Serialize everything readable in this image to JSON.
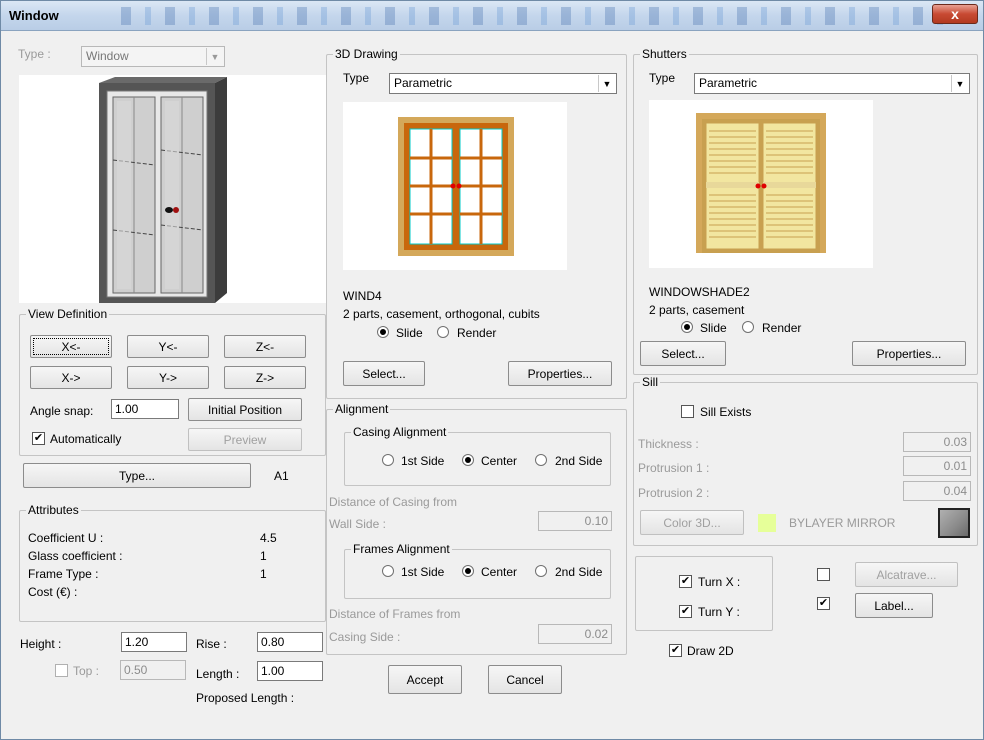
{
  "window": {
    "title": "Window",
    "close": "x"
  },
  "type_row": {
    "label": "Type :",
    "value": "Window"
  },
  "view_definition": {
    "legend": "View Definition",
    "buttons": [
      "X<-",
      "Y<-",
      "Z<-",
      "X->",
      "Y->",
      "Z->"
    ],
    "angle_snap_label": "Angle snap:",
    "angle_snap_value": "1.00",
    "initial_position": "Initial Position",
    "automatically_label": "Automatically",
    "automatically_checked": true,
    "preview": "Preview"
  },
  "type_button": "Type...",
  "type_code": "A1",
  "attributes": {
    "legend": "Attributes",
    "rows": [
      {
        "label": "Coefficient U :",
        "value": "4.5"
      },
      {
        "label": "Glass coefficient :",
        "value": "1"
      },
      {
        "label": "Frame Type :",
        "value": "1"
      },
      {
        "label": "Cost (€) :",
        "value": ""
      }
    ]
  },
  "dimensions": {
    "height_label": "Height :",
    "height_value": "1.20",
    "rise_label": "Rise :",
    "rise_value": "0.80",
    "top_label": "Top :",
    "top_value": "0.50",
    "length_label": "Length :",
    "length_value": "1.00",
    "proposed_length_label": "Proposed Length :"
  },
  "drawing3d": {
    "legend": "3D Drawing",
    "type_label": "Type",
    "type_value": "Parametric",
    "name": "WIND4",
    "description": "2 parts, casement, orthogonal, cubits",
    "slide": "Slide",
    "render": "Render",
    "selected_mode": "Slide",
    "select_btn": "Select...",
    "properties_btn": "Properties..."
  },
  "alignment": {
    "legend": "Alignment",
    "casing_legend": "Casing Alignment",
    "options": [
      "1st Side",
      "Center",
      "2nd Side"
    ],
    "casing_selected": "Center",
    "distance_casing_label": "Distance of Casing from",
    "wall_side_label": "Wall Side :",
    "wall_side_value": "0.10",
    "frames_legend": "Frames Alignment",
    "frames_selected": "Center",
    "distance_frames_label": "Distance of Frames from",
    "casing_side_label": "Casing Side :",
    "casing_side_value": "0.02"
  },
  "accept_btn": "Accept",
  "cancel_btn": "Cancel",
  "shutters": {
    "legend": "Shutters",
    "type_label": "Type",
    "type_value": "Parametric",
    "name": "WINDOWSHADE2",
    "description": "2 parts, casement",
    "slide": "Slide",
    "render": "Render",
    "selected_mode": "Slide",
    "select_btn": "Select...",
    "properties_btn": "Properties..."
  },
  "sill": {
    "legend": "Sill",
    "exists_label": "Sill Exists",
    "exists_checked": false,
    "thickness_label": "Thickness :",
    "thickness_value": "0.03",
    "protrusion1_label": "Protrusion 1 :",
    "protrusion1_value": "0.01",
    "protrusion2_label": "Protrusion 2 :",
    "protrusion2_value": "0.04",
    "color_btn": "Color 3D...",
    "color_name": "BYLAYER MIRROR",
    "swatch_color": "#e6ff99",
    "swatch2_color": "#8a8a8a"
  },
  "turns": {
    "turn_x_label": "Turn X :",
    "turn_x_checked": true,
    "turn_y_label": "Turn Y :",
    "turn_y_checked": true,
    "alcatrave_checked": false,
    "alcatrave_btn": "Alcatrave...",
    "label_checked": true,
    "label_btn": "Label..."
  },
  "draw2d": {
    "label": "Draw 2D",
    "checked": true
  },
  "colors": {
    "frame_wood": "#c8670c",
    "frame_outer": "#c8a050",
    "glass_line": "#00c8c8",
    "shutter_slat": "#f2e6a0",
    "handle": "#e00000"
  }
}
